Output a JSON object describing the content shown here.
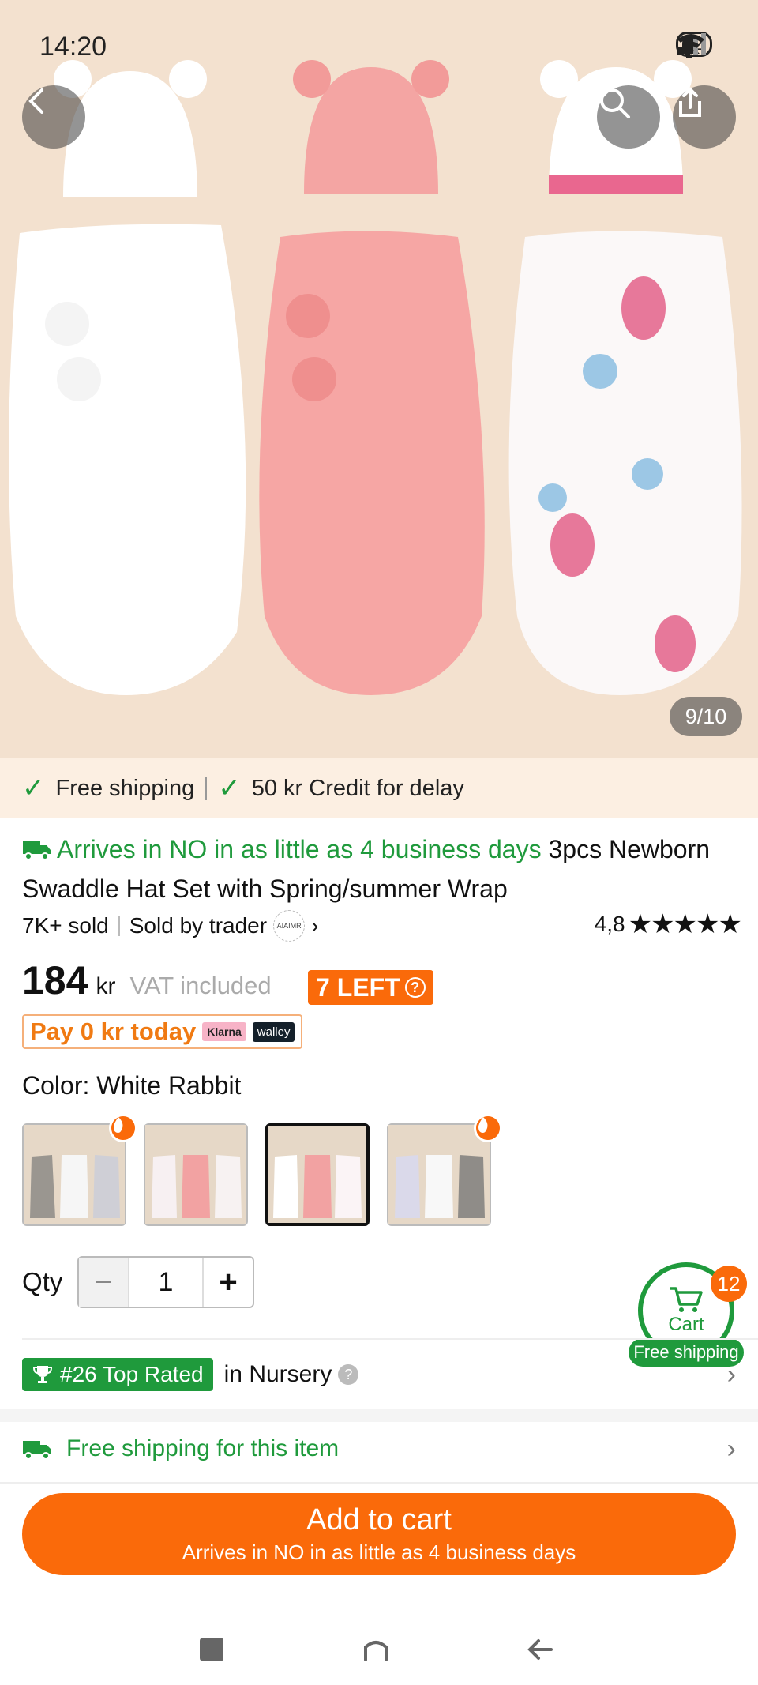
{
  "status": {
    "time": "14:20",
    "battery": "92"
  },
  "gallery": {
    "page_indicator": "9/10"
  },
  "shipping_strip": {
    "free_shipping": "Free shipping",
    "credit": "50 kr Credit for delay"
  },
  "product": {
    "arrives": "Arrives in NO in as little as 4 business days",
    "title_rest": " 3pcs Newborn Swaddle Hat Set with Spring/summer Wrap",
    "sold": "7K+ sold",
    "sold_by": "Sold by trader",
    "seller_logo": "AIAIMR",
    "rating": "4,8",
    "stars": "★★★★★"
  },
  "price": {
    "amount": "184",
    "currency": "kr",
    "vat": "VAT included",
    "stock": "7 LEFT",
    "pay_today": "Pay 0 kr today",
    "klarna": "Klarna",
    "walley": "walley"
  },
  "color": {
    "label": "Color: White Rabbit",
    "options": [
      {
        "name": "Gray set",
        "hot": true
      },
      {
        "name": "Pink floral set",
        "hot": false
      },
      {
        "name": "White Rabbit",
        "selected": true,
        "hot": false
      },
      {
        "name": "Blue gray set",
        "hot": true
      }
    ]
  },
  "qty": {
    "label": "Qty",
    "value": "1",
    "minus": "−",
    "plus": "+"
  },
  "cart": {
    "label": "Cart",
    "count": "12",
    "free_shipping": "Free shipping"
  },
  "rank": {
    "badge": "#26 Top Rated",
    "category": "in Nursery",
    "help": "?"
  },
  "free_item": {
    "label": "Free shipping for this item"
  },
  "cta": {
    "main": "Add to cart",
    "sub": "Arrives in NO in as little as 4 business days"
  },
  "colors": {
    "accent_orange": "#fa6a0a",
    "accent_green": "#1f9a3c",
    "strip_bg": "#fcefe2"
  }
}
